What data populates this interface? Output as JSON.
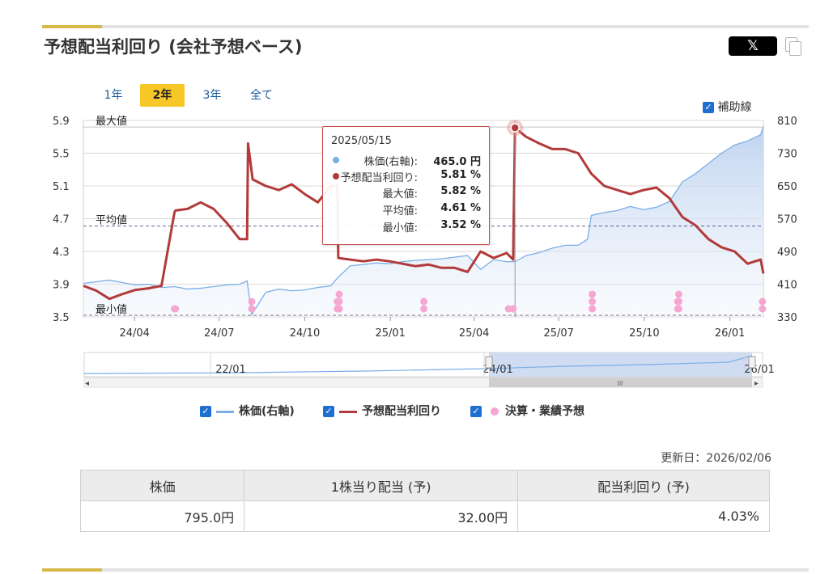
{
  "header": {
    "title": "予想配当利回り (会社予想ベース)",
    "share_x_label": "𝕏"
  },
  "periods": [
    {
      "label": "1年",
      "active": false
    },
    {
      "label": "2年",
      "active": true
    },
    {
      "label": "3年",
      "active": false
    },
    {
      "label": "全て",
      "active": false
    }
  ],
  "aux_lines_toggle": {
    "label": "補助線",
    "checked": true
  },
  "tooltip": {
    "date": "2025/05/15",
    "rows": [
      {
        "label": "株価(右軸):",
        "value": "465.0 円",
        "dot_color": "#7aaee8"
      },
      {
        "label": "予想配当利回り:",
        "value": "5.81 %",
        "dot_color": "#b23a3a"
      },
      {
        "label": "最大値:",
        "value": "5.82 %"
      },
      {
        "label": "平均値:",
        "value": "4.61 %"
      },
      {
        "label": "最小値:",
        "value": "3.52 %"
      }
    ]
  },
  "legend": [
    {
      "label": "株価(右軸)",
      "checked": true,
      "color": "#7aaee8",
      "marker": "line"
    },
    {
      "label": "予想配当利回り",
      "checked": true,
      "color": "#b23a3a",
      "marker": "line"
    },
    {
      "label": "決算・業績予想",
      "checked": true,
      "color": "#f5a7d2",
      "marker": "dot"
    }
  ],
  "updated": "更新日：2026/02/06",
  "summary": {
    "headers": [
      "株価",
      "1株当り配当 (予)",
      "配当利回り (予)"
    ],
    "values": [
      "795.0円",
      "32.00円",
      "4.03%"
    ]
  },
  "chart_data": {
    "type": "line",
    "x_range": [
      "2024-02-06",
      "2026-02-06"
    ],
    "xticks": [
      "24/04",
      "24/07",
      "24/10",
      "25/01",
      "25/04",
      "25/07",
      "25/10",
      "26/01"
    ],
    "left_axis": {
      "ticks": [
        "5.9",
        "5.5",
        "5.1",
        "4.7",
        "4.3",
        "3.9",
        "3.5"
      ],
      "range": [
        3.5,
        5.9
      ]
    },
    "right_axis": {
      "ticks": [
        "810",
        "730",
        "650",
        "570",
        "490",
        "410",
        "330"
      ],
      "range": [
        330,
        810
      ]
    },
    "reference_lines": [
      {
        "label": "最大値",
        "value": 5.82
      },
      {
        "label": "平均値",
        "value": 4.61
      },
      {
        "label": "最小値",
        "value": 3.52
      }
    ],
    "series": [
      {
        "name": "予想配当利回り",
        "color": "#b23a3a",
        "x": [
          "2024-02-06",
          "2024-02-20",
          "2024-03-05",
          "2024-03-19",
          "2024-04-02",
          "2024-04-16",
          "2024-04-30",
          "2024-05-14",
          "2024-05-15",
          "2024-05-28",
          "2024-06-11",
          "2024-06-25",
          "2024-07-09",
          "2024-07-23",
          "2024-07-31",
          "2024-08-01",
          "2024-08-06",
          "2024-08-20",
          "2024-09-03",
          "2024-09-17",
          "2024-10-01",
          "2024-10-15",
          "2024-10-29",
          "2024-11-05",
          "2024-11-06",
          "2024-11-19",
          "2024-12-03",
          "2024-12-17",
          "2024-12-31",
          "2025-01-14",
          "2025-01-28",
          "2025-02-11",
          "2025-02-25",
          "2025-03-11",
          "2025-03-25",
          "2025-04-08",
          "2025-04-22",
          "2025-05-06",
          "2025-05-13",
          "2025-05-15",
          "2025-05-27",
          "2025-06-10",
          "2025-06-24",
          "2025-07-08",
          "2025-07-22",
          "2025-08-05",
          "2025-08-19",
          "2025-09-02",
          "2025-09-16",
          "2025-09-30",
          "2025-10-14",
          "2025-10-28",
          "2025-11-11",
          "2025-11-25",
          "2025-12-09",
          "2025-12-23",
          "2026-01-06",
          "2026-01-20",
          "2026-02-03",
          "2026-02-06"
        ],
        "values": [
          3.88,
          3.82,
          3.72,
          3.78,
          3.83,
          3.85,
          3.88,
          4.78,
          4.8,
          4.82,
          4.9,
          4.82,
          4.65,
          4.45,
          4.45,
          5.62,
          5.18,
          5.1,
          5.05,
          5.12,
          5.0,
          4.9,
          5.1,
          5.1,
          4.22,
          4.2,
          4.18,
          4.2,
          4.18,
          4.15,
          4.12,
          4.14,
          4.1,
          4.1,
          4.05,
          4.3,
          4.22,
          4.28,
          4.2,
          5.81,
          5.7,
          5.62,
          5.55,
          5.55,
          5.5,
          5.25,
          5.1,
          5.05,
          5.0,
          5.05,
          5.08,
          4.95,
          4.72,
          4.62,
          4.45,
          4.35,
          4.3,
          4.15,
          4.2,
          4.03
        ]
      },
      {
        "name": "株価(右軸)",
        "color": "#7aaee8",
        "x": [
          "2024-02-06",
          "2024-02-20",
          "2024-03-05",
          "2024-03-19",
          "2024-04-02",
          "2024-04-16",
          "2024-04-30",
          "2024-05-14",
          "2024-05-28",
          "2024-06-11",
          "2024-06-25",
          "2024-07-09",
          "2024-07-23",
          "2024-07-31",
          "2024-08-05",
          "2024-08-20",
          "2024-09-03",
          "2024-09-17",
          "2024-10-01",
          "2024-10-15",
          "2024-10-29",
          "2024-11-05",
          "2024-11-19",
          "2024-12-03",
          "2024-12-17",
          "2024-12-31",
          "2025-01-14",
          "2025-01-28",
          "2025-02-11",
          "2025-02-25",
          "2025-03-11",
          "2025-03-25",
          "2025-04-08",
          "2025-04-22",
          "2025-05-06",
          "2025-05-15",
          "2025-05-27",
          "2025-06-10",
          "2025-06-24",
          "2025-07-08",
          "2025-07-22",
          "2025-08-01",
          "2025-08-05",
          "2025-08-19",
          "2025-09-02",
          "2025-09-16",
          "2025-09-30",
          "2025-10-14",
          "2025-10-28",
          "2025-11-11",
          "2025-11-25",
          "2025-12-09",
          "2025-12-23",
          "2026-01-06",
          "2026-01-20",
          "2026-02-03",
          "2026-02-06"
        ],
        "values": [
          412,
          416,
          420,
          414,
          408,
          410,
          402,
          404,
          398,
          400,
          404,
          408,
          410,
          418,
          336,
          390,
          398,
          394,
          396,
          402,
          406,
          425,
          455,
          458,
          462,
          460,
          465,
          468,
          470,
          472,
          476,
          480,
          446,
          470,
          465,
          465,
          480,
          487,
          498,
          505,
          505,
          520,
          578,
          585,
          590,
          600,
          592,
          598,
          612,
          660,
          680,
          705,
          730,
          750,
          760,
          775,
          795
        ]
      }
    ],
    "events": {
      "name": "決算・業績予想",
      "color": "#f5a7d2",
      "points": [
        {
          "date": "2024-05-14",
          "count": 1
        },
        {
          "date": "2024-05-15",
          "count": 1
        },
        {
          "date": "2024-08-05",
          "count": 2
        },
        {
          "date": "2024-11-05",
          "count": 2
        },
        {
          "date": "2024-11-07",
          "count": 3
        },
        {
          "date": "2025-02-06",
          "count": 2
        },
        {
          "date": "2025-05-08",
          "count": 1
        },
        {
          "date": "2025-05-13",
          "count": 1
        },
        {
          "date": "2025-08-06",
          "count": 3
        },
        {
          "date": "2025-11-06",
          "count": 2
        },
        {
          "date": "2025-11-07",
          "count": 3
        },
        {
          "date": "2026-02-05",
          "count": 2
        }
      ]
    },
    "navigator": {
      "labels": [
        "22/01",
        "24/01",
        "26/01"
      ]
    }
  }
}
